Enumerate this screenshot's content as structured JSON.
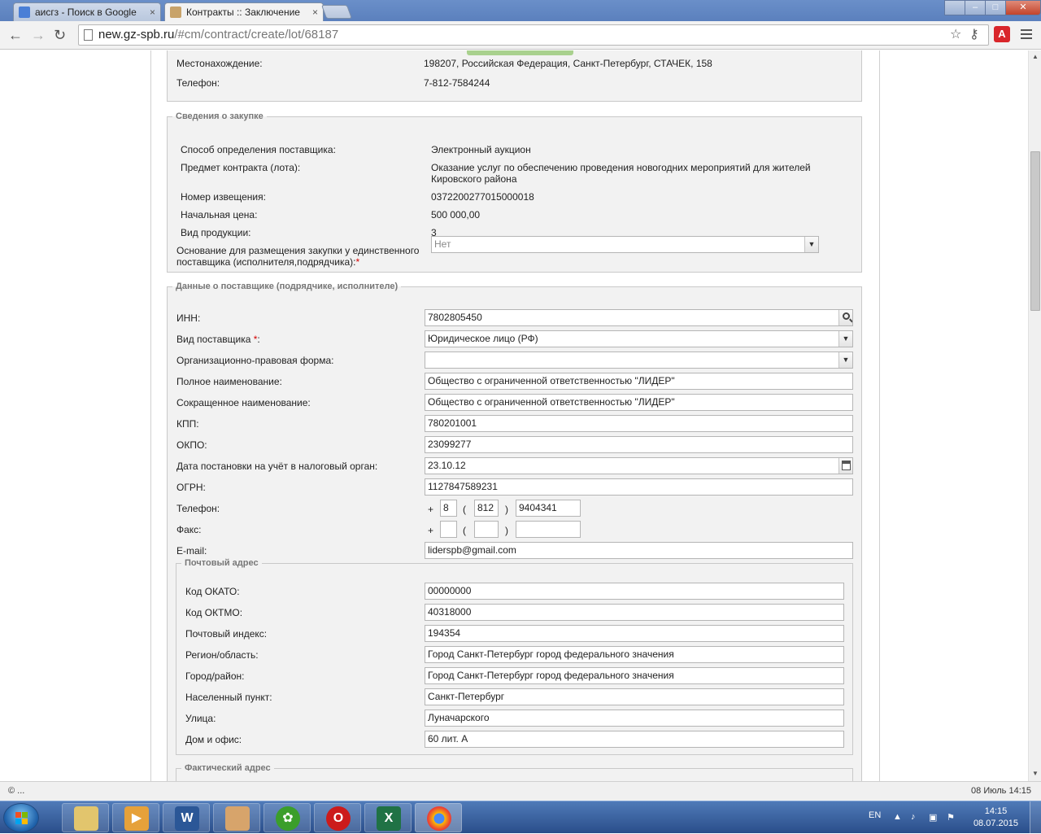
{
  "browser": {
    "tabs": [
      {
        "title": "аисгз - Поиск в Google",
        "close": "×"
      },
      {
        "title": "Контракты :: Заключение",
        "close": "×"
      }
    ],
    "url_host": "new.gz-spb.ru",
    "url_path": "/#cm/contract/create/lot/68187",
    "window_controls": {
      "minimize": "–",
      "maximize": "□",
      "close": "✕"
    },
    "extension_label": "A",
    "star_icon": "☆",
    "key_icon": "⚷"
  },
  "customer": {
    "location_label": "Местонахождение:",
    "location_value": "198207, Российская Федерация, Санкт-Петербург, СТАЧЕК, 158",
    "phone_label": "Телефон:",
    "phone_value": "7-812-7584244"
  },
  "purchase": {
    "legend": "Сведения о закупке",
    "method_label": "Способ определения поставщика:",
    "method_value": "Электронный аукцион",
    "subject_label": "Предмет контракта (лота):",
    "subject_value": "Оказание услуг по обеспечению проведения новогодних мероприятий для жителей Кировского района",
    "notice_label": "Номер извещения:",
    "notice_value": "0372200277015000018",
    "price_label": "Начальная цена:",
    "price_value": "500 000,00",
    "product_type_label": "Вид продукции:",
    "product_type_value": "3",
    "sole_basis_label": "Основание для размещения закупки у единственного поставщика (исполнителя,подрядчика):",
    "sole_basis_value": "Нет"
  },
  "supplier": {
    "legend": "Данные о поставщике (подрядчике, исполнителе)",
    "inn_label": "ИНН:",
    "inn_value": "7802805450",
    "type_label": "Вид поставщика",
    "type_value": "Юридическое лицо (РФ)",
    "legal_form_label": "Организационно-правовая форма:",
    "legal_form_value": "",
    "full_name_label": "Полное наименование:",
    "full_name_value": "Общество с ограниченной ответственностью \"ЛИДЕР\"",
    "short_name_label": "Сокращенное наименование:",
    "short_name_value": "Общество с ограниченной ответственностью \"ЛИДЕР\"",
    "kpp_label": "КПП:",
    "kpp_value": "780201001",
    "okpo_label": "ОКПО:",
    "okpo_value": "23099277",
    "tax_date_label": "Дата постановки на учёт в налоговый орган:",
    "tax_date_value": "23.10.12",
    "ogrn_label": "ОГРН:",
    "ogrn_value": "1127847589231",
    "phone_label": "Телефон:",
    "phone_country": "8",
    "phone_code": "812",
    "phone_number": "9404341",
    "fax_label": "Факс:",
    "fax_country": "",
    "fax_code": "",
    "fax_number": "",
    "email_label": "E-mail:",
    "email_value": "liderspb@gmail.com",
    "plus": "+",
    "paren_open": "(",
    "paren_close": ")",
    "colon": ":",
    "required_mark": "*"
  },
  "postal": {
    "legend": "Почтовый адрес",
    "okato_label": "Код ОКАТО:",
    "okato_value": "00000000",
    "oktmo_label": "Код ОКТМО:",
    "oktmo_value": "40318000",
    "index_label": "Почтовый индекс:",
    "index_value": "194354",
    "region_label": "Регион/область:",
    "region_value": "Город Санкт-Петербург город федерального значения",
    "city_label": "Город/район:",
    "city_value": "Город Санкт-Петербург город федерального значения",
    "settlement_label": "Населенный пункт:",
    "settlement_value": "Санкт-Петербург",
    "street_label": "Улица:",
    "street_value": "Луначарского",
    "house_label": "Дом и офис:",
    "house_value": "60 лит. А"
  },
  "actual": {
    "legend": "Фактический адрес"
  },
  "statusbar": {
    "left": "© ...",
    "right": "08 Июль 14:15"
  },
  "taskbar": {
    "lang": "EN",
    "time": "14:15",
    "date": "08.07.2015",
    "tray_chevron": "▲"
  }
}
